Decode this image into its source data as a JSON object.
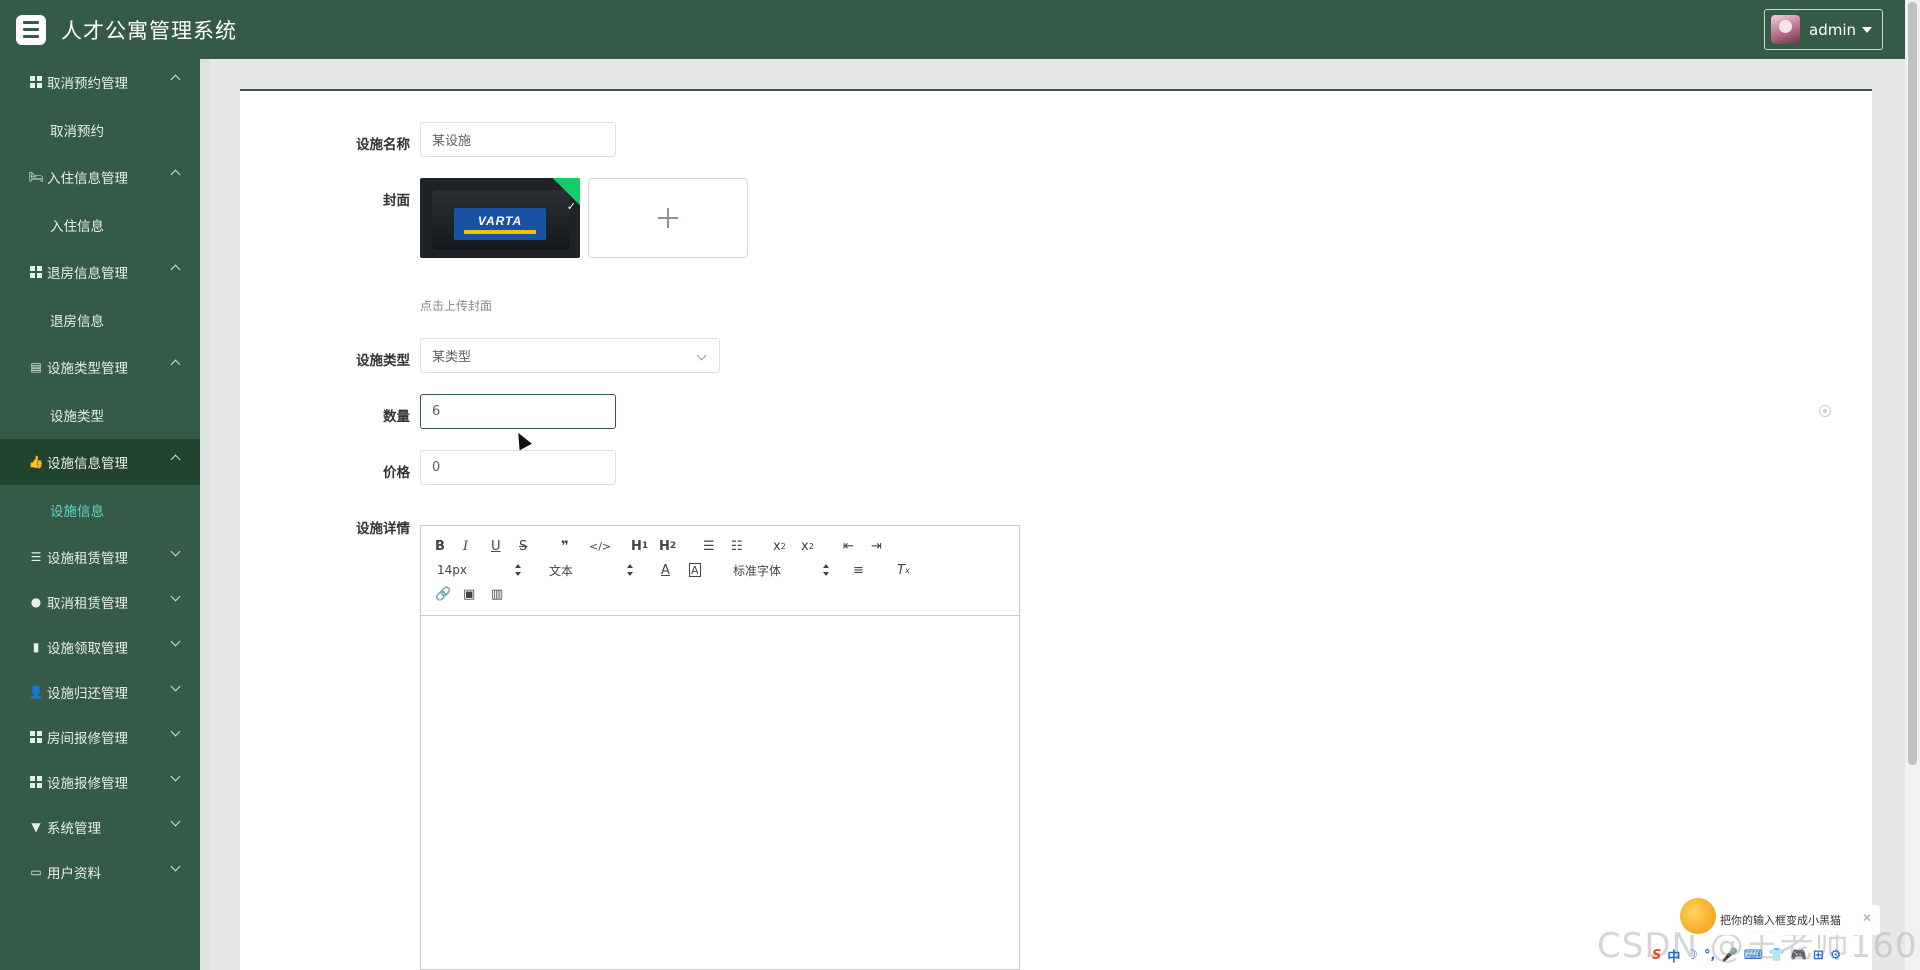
{
  "header": {
    "title": "人才公寓管理系统",
    "user": "admin"
  },
  "sidebar": {
    "groups": [
      {
        "label": "取消预约管理",
        "icon": "grid-icon",
        "expanded": true,
        "sub": "取消预约"
      },
      {
        "label": "入住信息管理",
        "icon": "bed-icon",
        "expanded": true,
        "sub": "入住信息"
      },
      {
        "label": "退房信息管理",
        "icon": "grid-icon",
        "expanded": true,
        "sub": "退房信息"
      },
      {
        "label": "设施类型管理",
        "icon": "clipboard-icon",
        "expanded": true,
        "sub": "设施类型"
      },
      {
        "label": "设施信息管理",
        "icon": "thumbs-up-icon",
        "expanded": true,
        "sub": "设施信息",
        "active": true
      },
      {
        "label": "设施租赁管理",
        "icon": "sliders-icon"
      },
      {
        "label": "取消租赁管理",
        "icon": "location-icon"
      },
      {
        "label": "设施领取管理",
        "icon": "bar-chart-icon"
      },
      {
        "label": "设施归还管理",
        "icon": "user-icon"
      },
      {
        "label": "房间报修管理",
        "icon": "grid-icon"
      },
      {
        "label": "设施报修管理",
        "icon": "grid-icon"
      },
      {
        "label": "系统管理",
        "icon": "filter-icon"
      },
      {
        "label": "用户资料",
        "icon": "card-icon"
      }
    ]
  },
  "form": {
    "name_label": "设施名称",
    "name_value": "某设施",
    "cover_label": "封面",
    "cover_brand": "VARTA",
    "cover_hint": "点击上传封面",
    "type_label": "设施类型",
    "type_value": "某类型",
    "qty_label": "数量",
    "qty_value": "6",
    "price_label": "价格",
    "price_value": "0",
    "detail_label": "设施详情"
  },
  "editor": {
    "font_size": "14px",
    "format": "文本",
    "font_family": "标准字体"
  },
  "overlay": {
    "watermark": "CSDN @王老师160",
    "ime_tip": "把你的输入框变成小黑猫",
    "ime_items": [
      "S",
      "中",
      "☽",
      "°,",
      "🎤",
      "⌨",
      "👕",
      "🎮",
      "⊞",
      "⚙"
    ]
  }
}
